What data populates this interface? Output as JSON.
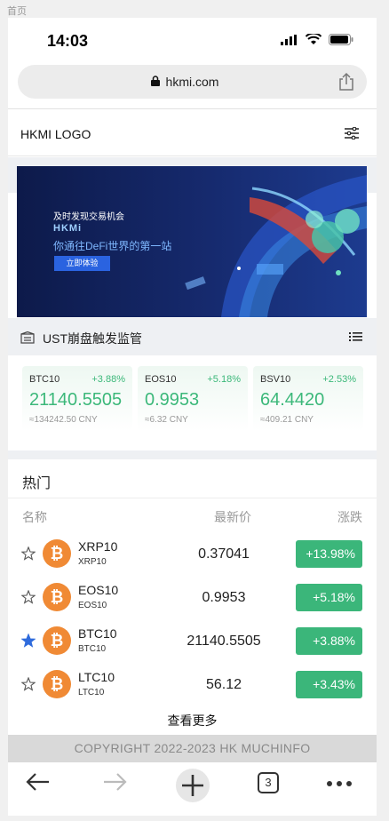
{
  "page_label": "首页",
  "status_bar": {
    "time": "14:03"
  },
  "browser": {
    "url": "hkmi.com",
    "tab_count": "3"
  },
  "header": {
    "logo": "HKMI LOGO"
  },
  "banner": {
    "line1": "及时发现交易机会",
    "logo": "HKMi",
    "line2": "你通往DeFi世界的第一站",
    "button": "立即体验"
  },
  "notice": {
    "text": "UST崩盘触发监管"
  },
  "tickers": [
    {
      "name": "BTC10",
      "pct": "+3.88%",
      "price": "21140.5505",
      "cny": "≈134242.50 CNY"
    },
    {
      "name": "EOS10",
      "pct": "+5.18%",
      "price": "0.9953",
      "cny": "≈6.32 CNY"
    },
    {
      "name": "BSV10",
      "pct": "+2.53%",
      "price": "64.4420",
      "cny": "≈409.21 CNY"
    }
  ],
  "hot": {
    "title": "热门",
    "columns": {
      "name": "名称",
      "price": "最新价",
      "change": "涨跌"
    },
    "rows": [
      {
        "name": "XRP10",
        "sub": "XRP10",
        "price": "0.37041",
        "pct": "+13.98%",
        "favorited": false
      },
      {
        "name": "EOS10",
        "sub": "EOS10",
        "price": "0.9953",
        "pct": "+5.18%",
        "favorited": false
      },
      {
        "name": "BTC10",
        "sub": "BTC10",
        "price": "21140.5505",
        "pct": "+3.88%",
        "favorited": true
      },
      {
        "name": "LTC10",
        "sub": "LTC10",
        "price": "56.12",
        "pct": "+3.43%",
        "favorited": false
      }
    ],
    "more": "查看更多"
  },
  "footer": {
    "copyright": "COPYRIGHT 2022-2023 HK MUCHINFO"
  },
  "colors": {
    "green": "#3bb67a",
    "star_active": "#2f6bdc",
    "coin": "#f08a35",
    "banner_bg": "#0d1a4a"
  },
  "icons": [
    "lock-icon",
    "share-icon",
    "filter-icon",
    "notice-icon",
    "list-icon",
    "star-icon",
    "bitcoin-icon",
    "back-icon",
    "forward-icon",
    "new-tab-icon",
    "tabs-icon",
    "more-icon"
  ]
}
